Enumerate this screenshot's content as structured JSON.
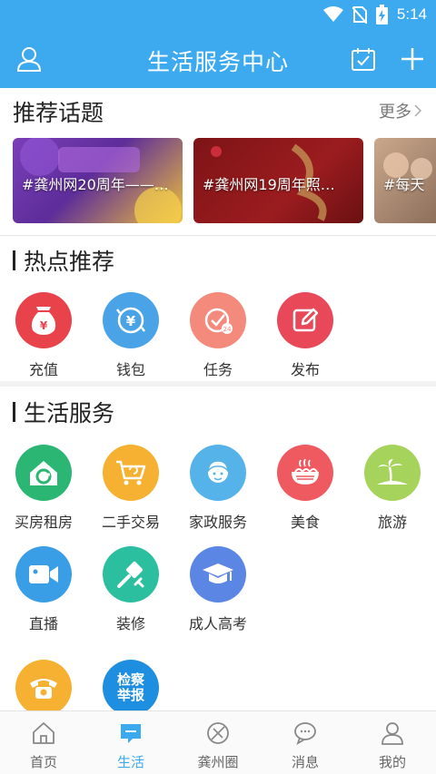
{
  "status_bar": {
    "time": "5:14"
  },
  "app_bar": {
    "title": "生活服务中心"
  },
  "topics": {
    "title": "推荐话题",
    "more": "更多",
    "cards": [
      {
        "label": "#龚州网20周年——…"
      },
      {
        "label": "#龚州网19周年照…"
      },
      {
        "label": "#每天"
      }
    ]
  },
  "hot": {
    "title": "热点推荐",
    "items": [
      {
        "label": "充值",
        "icon": "money-bag-icon",
        "color": "#e8424a"
      },
      {
        "label": "钱包",
        "icon": "wallet-yen-icon",
        "color": "#4aa3e6"
      },
      {
        "label": "任务",
        "icon": "task-icon",
        "color": "#f48a7c"
      },
      {
        "label": "发布",
        "icon": "edit-icon",
        "color": "#e84858"
      }
    ]
  },
  "services": {
    "title": "生活服务",
    "items": [
      {
        "label": "买房租房",
        "icon": "house-icon",
        "color": "#2bb673"
      },
      {
        "label": "二手交易",
        "icon": "cart-icon",
        "color": "#f6b132"
      },
      {
        "label": "家政服务",
        "icon": "housekeeping-icon",
        "color": "#56b3ea"
      },
      {
        "label": "美食",
        "icon": "noodle-bowl-icon",
        "color": "#ee5a5f"
      },
      {
        "label": "旅游",
        "icon": "palm-tree-icon",
        "color": "#a5d35b"
      },
      {
        "label": "直播",
        "icon": "video-camera-icon",
        "color": "#3a9ee6"
      },
      {
        "label": "装修",
        "icon": "brush-icon",
        "color": "#2bbfa0"
      },
      {
        "label": "成人高考",
        "icon": "graduation-cap-icon",
        "color": "#5c86e3"
      },
      {
        "label": "",
        "icon": "phone-icon",
        "color": "#f6b132"
      },
      {
        "label": "",
        "icon": "report-badge-icon",
        "color": "#1e8ee0",
        "badge_text": "检察举报"
      }
    ]
  },
  "bottom_nav": {
    "items": [
      {
        "label": "首页",
        "icon": "home-icon"
      },
      {
        "label": "生活",
        "icon": "life-chat-icon",
        "active": true
      },
      {
        "label": "龚州圈",
        "icon": "circle-compass-icon"
      },
      {
        "label": "消息",
        "icon": "message-icon"
      },
      {
        "label": "我的",
        "icon": "user-icon"
      }
    ]
  },
  "colors": {
    "primary": "#3daaf0",
    "active_nav": "#3daaf0"
  }
}
